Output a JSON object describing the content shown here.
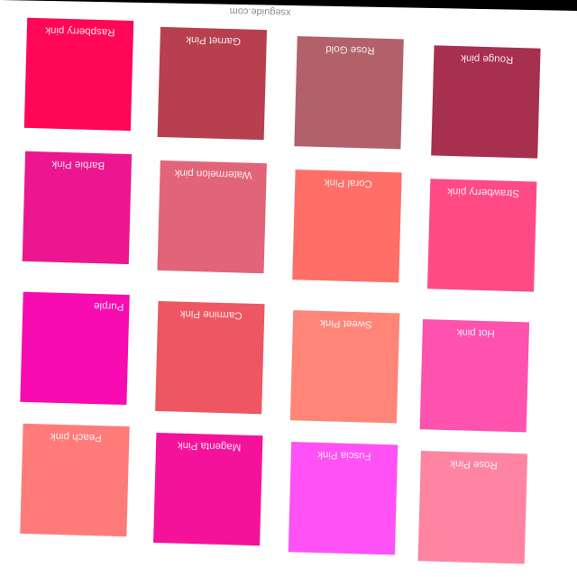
{
  "source": "xseguide.com",
  "swatches": [
    {
      "name": "Raspberry pink",
      "color": "#FF0657"
    },
    {
      "name": "Garnet Pink",
      "color": "#B83F4E"
    },
    {
      "name": "Rose Gold",
      "color": "#B2616B"
    },
    {
      "name": "Rouge pink",
      "color": "#A8304F"
    },
    {
      "name": "Barbie Pink",
      "color": "#EC1690"
    },
    {
      "name": "Watermelon pink",
      "color": "#E26478"
    },
    {
      "name": "Coral Pink",
      "color": "#FF6E67"
    },
    {
      "name": "Strawberry pink",
      "color": "#FF4A86"
    },
    {
      "name": "Purple",
      "color": "#F80BB0"
    },
    {
      "name": "Carmine Pink",
      "color": "#EE5762"
    },
    {
      "name": "Sweet Pink",
      "color": "#FF8578"
    },
    {
      "name": "Hot pink",
      "color": "#FF51AE"
    },
    {
      "name": "Peach pink",
      "color": "#FF7B7A"
    },
    {
      "name": "Magenta Pink",
      "color": "#F5129A"
    },
    {
      "name": "Fuscia Pink",
      "color": "#FF51F5"
    },
    {
      "name": "Rose Pink",
      "color": "#FF84A2"
    }
  ]
}
